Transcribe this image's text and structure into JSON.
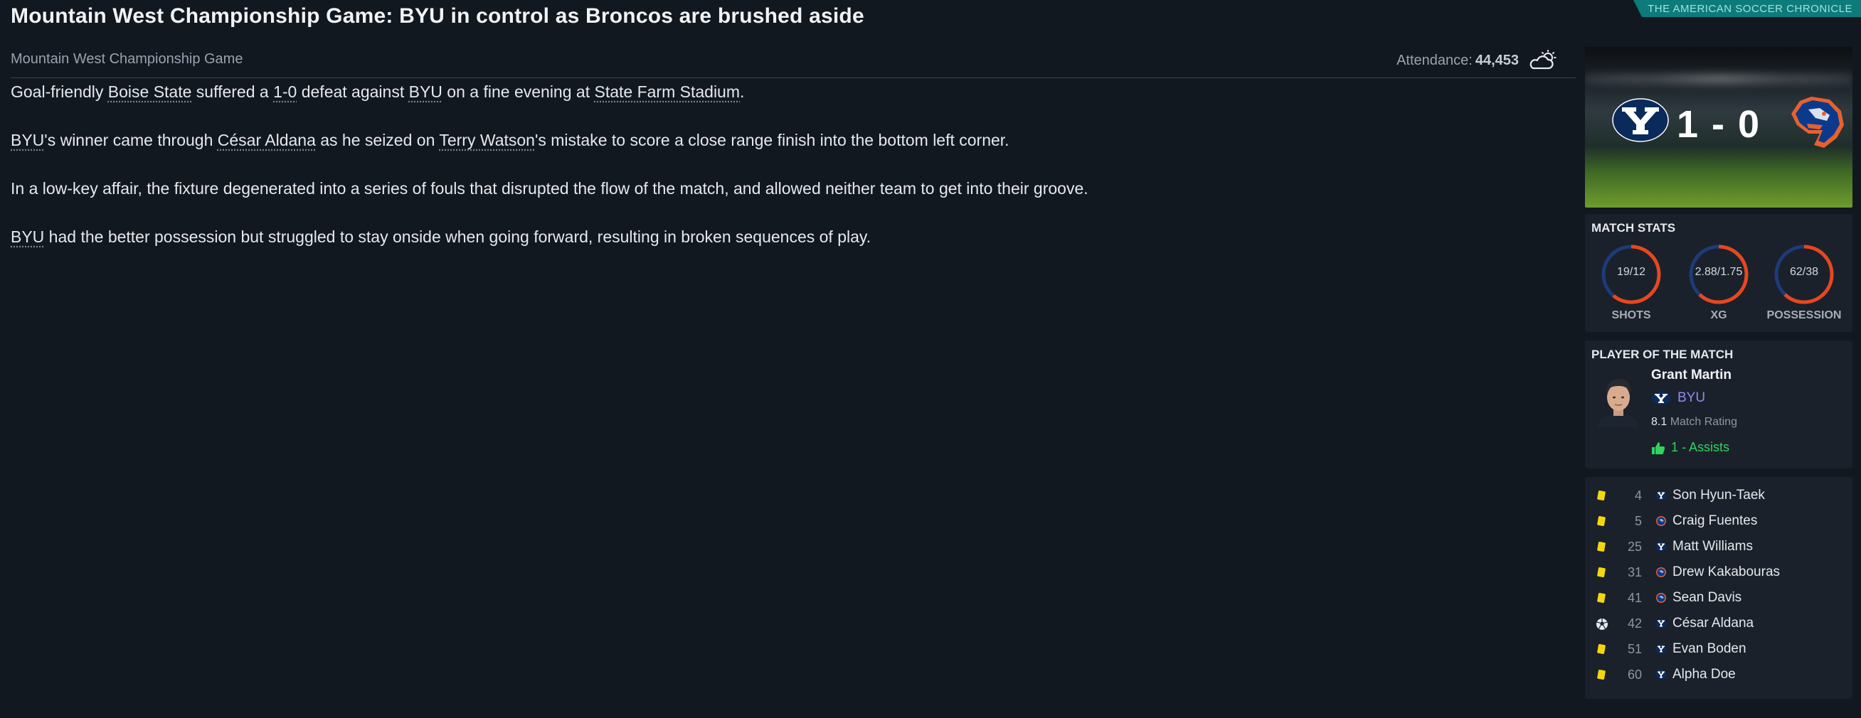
{
  "headline": "Mountain West Championship Game: BYU in control as Broncos are brushed aside",
  "brand": "THE AMERICAN SOCCER CHRONICLE",
  "competition": "Mountain West Championship Game",
  "attendance": {
    "label": "Attendance:",
    "value": "44,453"
  },
  "weather_icon": "partly-cloudy-icon",
  "article": {
    "p1": {
      "a": "Goal-friendly ",
      "team1": "Boise State",
      "b": " suffered a ",
      "score": "1-0",
      "c": " defeat against ",
      "team2": "BYU",
      "d": " on a fine evening at ",
      "venue": "State Farm Stadium",
      "e": "."
    },
    "p2": {
      "team": "BYU",
      "a": "'s winner came through ",
      "scorer": "César Aldana",
      "b": " as he seized on ",
      "culprit": "Terry Watson",
      "c": "'s mistake to score a close range finish into the bottom left corner."
    },
    "p3": {
      "text": "In a low-key affair, the fixture degenerated into a series of fouls that disrupted the flow of the match, and allowed neither team to get into their groove."
    },
    "p4": {
      "team": "BYU",
      "a": " had the better possession but struggled to stay onside when going forward, resulting in broken sequences of play."
    }
  },
  "scoreboard": {
    "score": "1 - 0",
    "home_score": 1,
    "away_score": 0,
    "home_crest": "byu-crest-icon",
    "away_crest": "broncos-crest-icon"
  },
  "match_stats": {
    "title": "MATCH STATS",
    "items": [
      {
        "value": "19/12",
        "label": "SHOTS",
        "home_share": 0.61
      },
      {
        "value": "2.88/1.75",
        "label": "XG",
        "home_share": 0.62
      },
      {
        "value": "62/38",
        "label": "POSSESSION",
        "home_share": 0.62
      }
    ]
  },
  "player_of_match": {
    "title": "PLAYER OF THE MATCH",
    "name": "Grant Martin",
    "team": "BYU",
    "rating_value": "8.1",
    "rating_label": "Match Rating",
    "assists": "1 - Assists"
  },
  "events": [
    {
      "type": "yellow-card",
      "minute": "4",
      "team": "byu",
      "player": "Son Hyun-Taek"
    },
    {
      "type": "yellow-card",
      "minute": "5",
      "team": "boise",
      "player": "Craig Fuentes"
    },
    {
      "type": "yellow-card",
      "minute": "25",
      "team": "byu",
      "player": "Matt Williams"
    },
    {
      "type": "yellow-card",
      "minute": "31",
      "team": "boise",
      "player": "Drew Kakabouras"
    },
    {
      "type": "yellow-card",
      "minute": "41",
      "team": "boise",
      "player": "Sean Davis"
    },
    {
      "type": "goal",
      "minute": "42",
      "team": "byu",
      "player": "César Aldana"
    },
    {
      "type": "yellow-card",
      "minute": "51",
      "team": "byu",
      "player": "Evan Boden"
    },
    {
      "type": "yellow-card",
      "minute": "60",
      "team": "byu",
      "player": "Alpha Doe"
    }
  ],
  "colors": {
    "background": "#121820",
    "panel": "#1a212b",
    "accent_orange": "#e8471d",
    "ring_track": "#1d3b78",
    "assist_green": "#2fd35e",
    "team_link": "#8f8cf0",
    "brand_teal": "#0d7b7a"
  }
}
